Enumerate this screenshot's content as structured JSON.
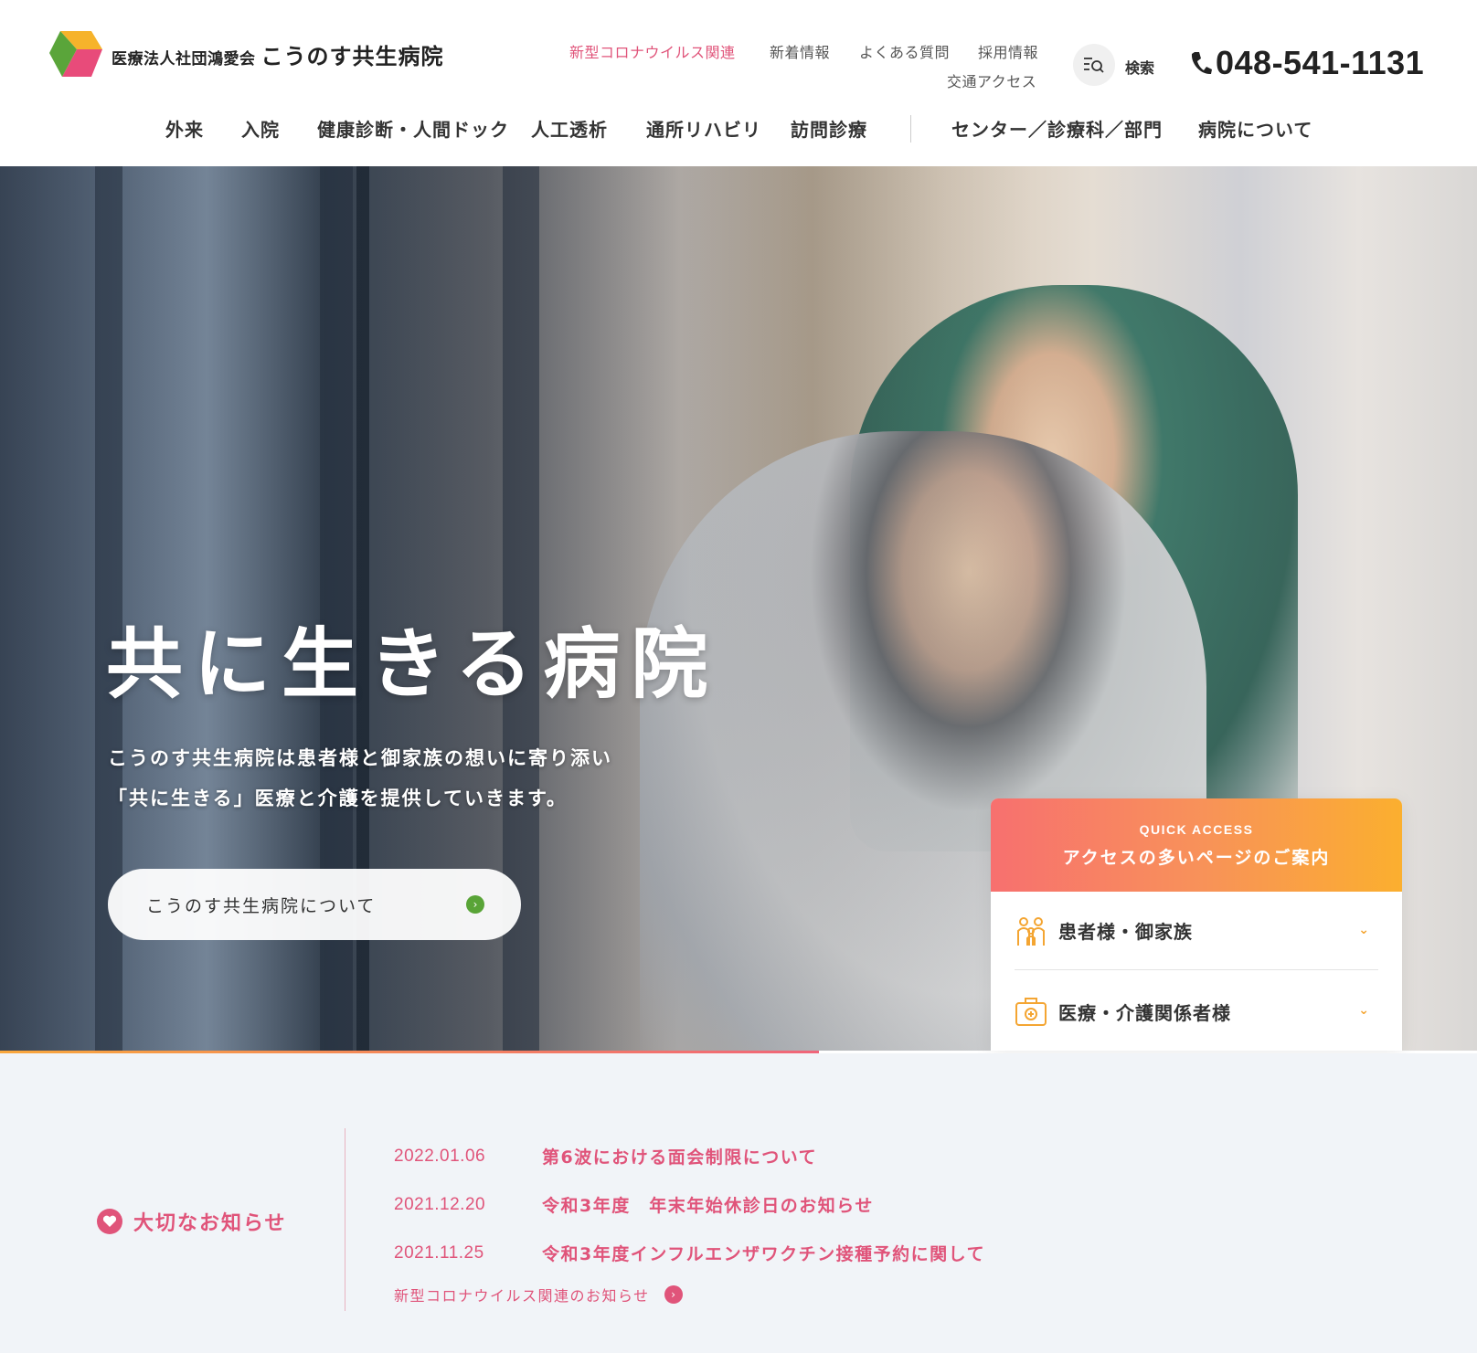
{
  "header": {
    "logo_corp": "医療法人社団鴻愛会",
    "logo_name": "こうのす共生病院",
    "utility_links": [
      "新型コロナウイルス関連",
      "新着情報",
      "よくある質問",
      "採用情報",
      "交通アクセス"
    ],
    "search_label": "検索",
    "phone": "048-541-1131"
  },
  "main_nav": [
    "外来",
    "入院",
    "健康診断・人間ドック",
    "人工透析",
    "通所リハビリ",
    "訪問診療",
    "センター／診療科／部門",
    "病院について"
  ],
  "hero": {
    "title": "共に生きる病院",
    "lines": [
      "こうのす共生病院は患者様と御家族の想いに寄り添い",
      "「共に生きる」医療と介護を提供していきます。"
    ],
    "button_label": "こうのす共生病院について"
  },
  "quick_access": {
    "eyebrow": "QUICK ACCESS",
    "title": "アクセスの多いページのご案内",
    "items": [
      {
        "label": "患者様・御家族",
        "icon": "family-icon"
      },
      {
        "label": "医療・介護関係者様",
        "icon": "medical-kit-icon"
      }
    ]
  },
  "notices": {
    "heading": "大切なお知らせ",
    "items": [
      {
        "date": "2022.01.06",
        "title": "第6波における面会制限について"
      },
      {
        "date": "2021.12.20",
        "title": "令和3年度　年末年始休診日のお知らせ"
      },
      {
        "date": "2021.11.25",
        "title": "令和3年度インフルエンザワクチン接種予約に関して"
      }
    ],
    "more_label": "新型コロナウイルス関連のお知らせ"
  },
  "colors": {
    "accent_pink": "#e0547a",
    "accent_green": "#59a437",
    "gradient_start": "#f7706f",
    "gradient_end": "#fbaf2f",
    "notice_bg": "#f1f4f8"
  }
}
